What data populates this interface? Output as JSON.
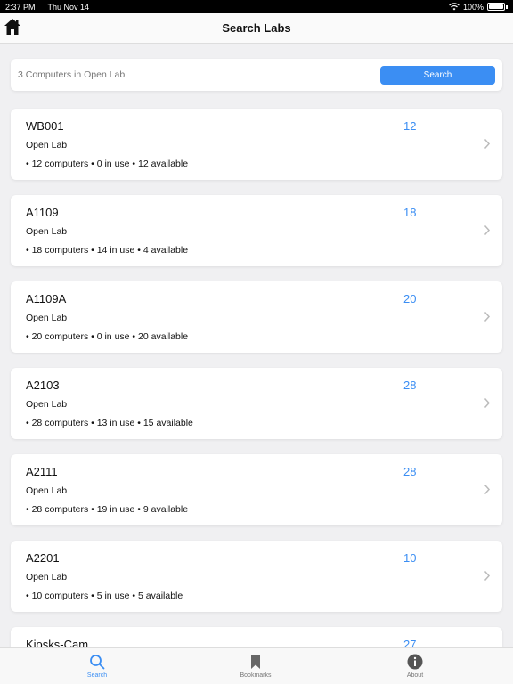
{
  "status_bar": {
    "time": "2:37 PM",
    "date": "Thu Nov 14",
    "battery": "100%"
  },
  "nav": {
    "title": "Search Labs",
    "home_icon": "home-icon"
  },
  "search": {
    "placeholder": "3 Computers in Open Lab",
    "button_label": "Search"
  },
  "labs": [
    {
      "name": "WB001",
      "type": "Open Lab",
      "stats": "• 12 computers  • 0 in use  • 12 available",
      "count": "12"
    },
    {
      "name": "A1109",
      "type": "Open Lab",
      "stats": "• 18 computers  • 14 in use  • 4 available",
      "count": "18"
    },
    {
      "name": "A1109A",
      "type": "Open Lab",
      "stats": "• 20 computers  • 0 in use  • 20 available",
      "count": "20"
    },
    {
      "name": "A2103",
      "type": "Open Lab",
      "stats": "• 28 computers  • 13 in use  • 15 available",
      "count": "28"
    },
    {
      "name": "A2111",
      "type": "Open Lab",
      "stats": "• 28 computers  • 19 in use  • 9 available",
      "count": "28"
    },
    {
      "name": "A2201",
      "type": "Open Lab",
      "stats": "• 10 computers  • 5 in use  • 5 available",
      "count": "10"
    },
    {
      "name": "Kiosks-Cam",
      "type": "",
      "stats": "",
      "count": "27"
    }
  ],
  "tabs": [
    {
      "label": "Search",
      "icon": "search-icon",
      "active": true
    },
    {
      "label": "Bookmarks",
      "icon": "bookmark-icon",
      "active": false
    },
    {
      "label": "About",
      "icon": "info-icon",
      "active": false
    }
  ],
  "colors": {
    "accent": "#3b8ef3",
    "background": "#f0f0f2",
    "card": "#ffffff"
  }
}
